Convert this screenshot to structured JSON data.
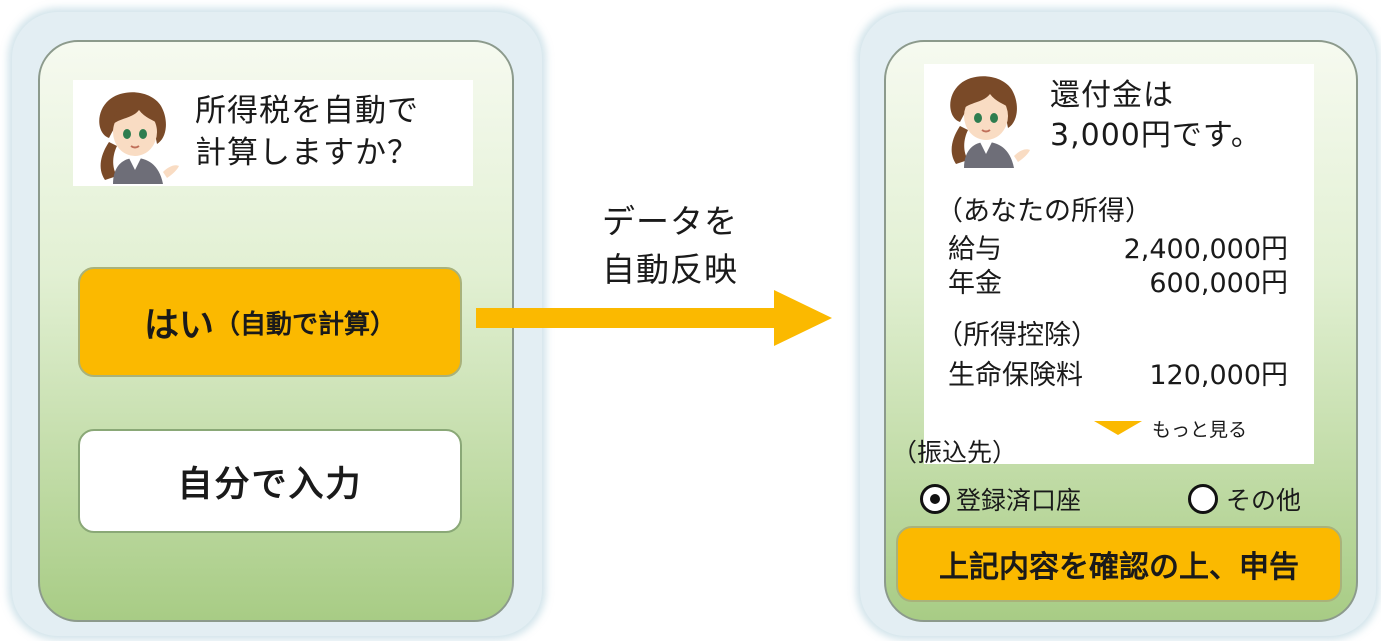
{
  "left_phone": {
    "question": "所得税を自動で計算しますか？",
    "question_line1": "所得税を自動で",
    "question_line2": "計算しますか？",
    "yes_button_main": "はい",
    "yes_button_sub": "（自動で計算）",
    "self_input_button": "自分で入力"
  },
  "arrow": {
    "label_line1": "データを",
    "label_line2": "自動反映",
    "color": "#fbb900"
  },
  "right_phone": {
    "refund_line1": "還付金は",
    "refund_line2": "3,000円です。",
    "income_heading": "（あなたの所得）",
    "income_items": [
      {
        "label": "給与",
        "amount": "2,400,000円"
      },
      {
        "label": "年金",
        "amount": "600,000円"
      }
    ],
    "deduction_heading": "（所得控除）",
    "deduction_items": [
      {
        "label": "生命保険料",
        "amount": "120,000円"
      }
    ],
    "more_link": "もっと見る",
    "transfer_heading": "（振込先）",
    "transfer_options": [
      {
        "label": "登録済口座",
        "selected": true
      },
      {
        "label": "その他",
        "selected": false
      }
    ],
    "submit_button": "上記内容を確認の上、申告"
  },
  "colors": {
    "accent": "#fbb900",
    "screen_green": "#a8cc85",
    "frame": "#e3eef3"
  },
  "icons": {
    "avatar": "woman-avatar-icon",
    "more": "triangle-down-icon",
    "arrow": "right-arrow-icon"
  }
}
